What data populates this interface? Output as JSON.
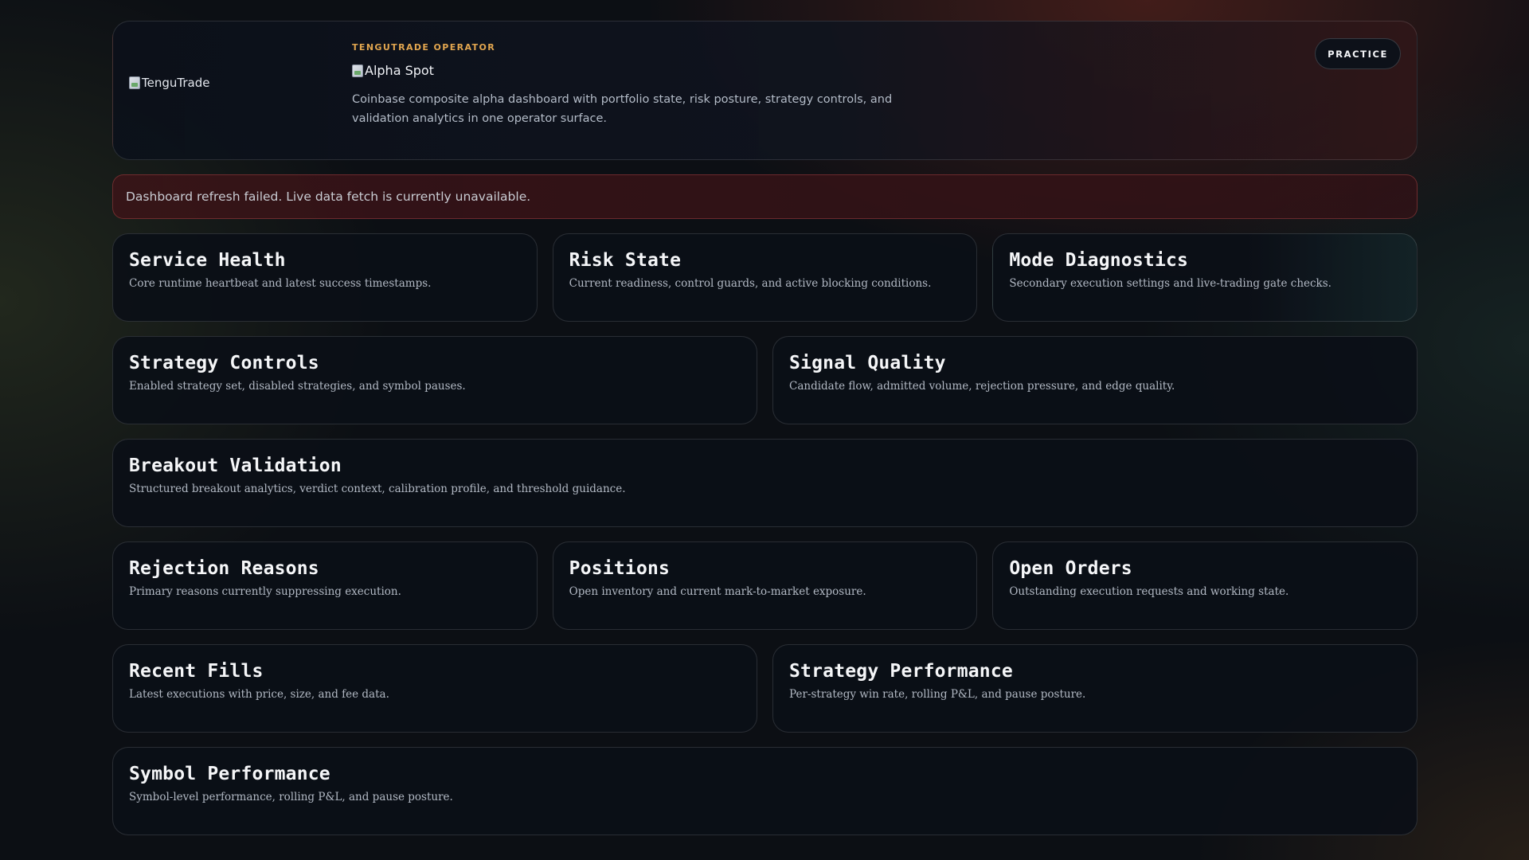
{
  "header": {
    "logo_alt": "TenguTrade",
    "eyebrow": "TENGUTRADE OPERATOR",
    "title_alt": "Alpha Spot",
    "description": "Coinbase composite alpha dashboard with portfolio state, risk posture, strategy controls, and validation analytics in one operator surface.",
    "mode_badge": "PRACTICE"
  },
  "alert": {
    "message": "Dashboard refresh failed. Live data fetch is currently unavailable."
  },
  "panels": [
    {
      "title": "Service Health",
      "subtitle": "Core runtime heartbeat and latest success timestamps."
    },
    {
      "title": "Risk State",
      "subtitle": "Current readiness, control guards, and active blocking conditions."
    },
    {
      "title": "Mode Diagnostics",
      "subtitle": "Secondary execution settings and live-trading gate checks."
    },
    {
      "title": "Strategy Controls",
      "subtitle": "Enabled strategy set, disabled strategies, and symbol pauses."
    },
    {
      "title": "Signal Quality",
      "subtitle": "Candidate flow, admitted volume, rejection pressure, and edge quality."
    },
    {
      "title": "Breakout Validation",
      "subtitle": "Structured breakout analytics, verdict context, calibration profile, and threshold guidance."
    },
    {
      "title": "Rejection Reasons",
      "subtitle": "Primary reasons currently suppressing execution."
    },
    {
      "title": "Positions",
      "subtitle": "Open inventory and current mark-to-market exposure."
    },
    {
      "title": "Open Orders",
      "subtitle": "Outstanding execution requests and working state."
    },
    {
      "title": "Recent Fills",
      "subtitle": "Latest executions with price, size, and fee data."
    },
    {
      "title": "Strategy Performance",
      "subtitle": "Per-strategy win rate, rolling P&L, and pause posture."
    },
    {
      "title": "Symbol Performance",
      "subtitle": "Symbol-level performance, rolling P&L, and pause posture."
    }
  ]
}
